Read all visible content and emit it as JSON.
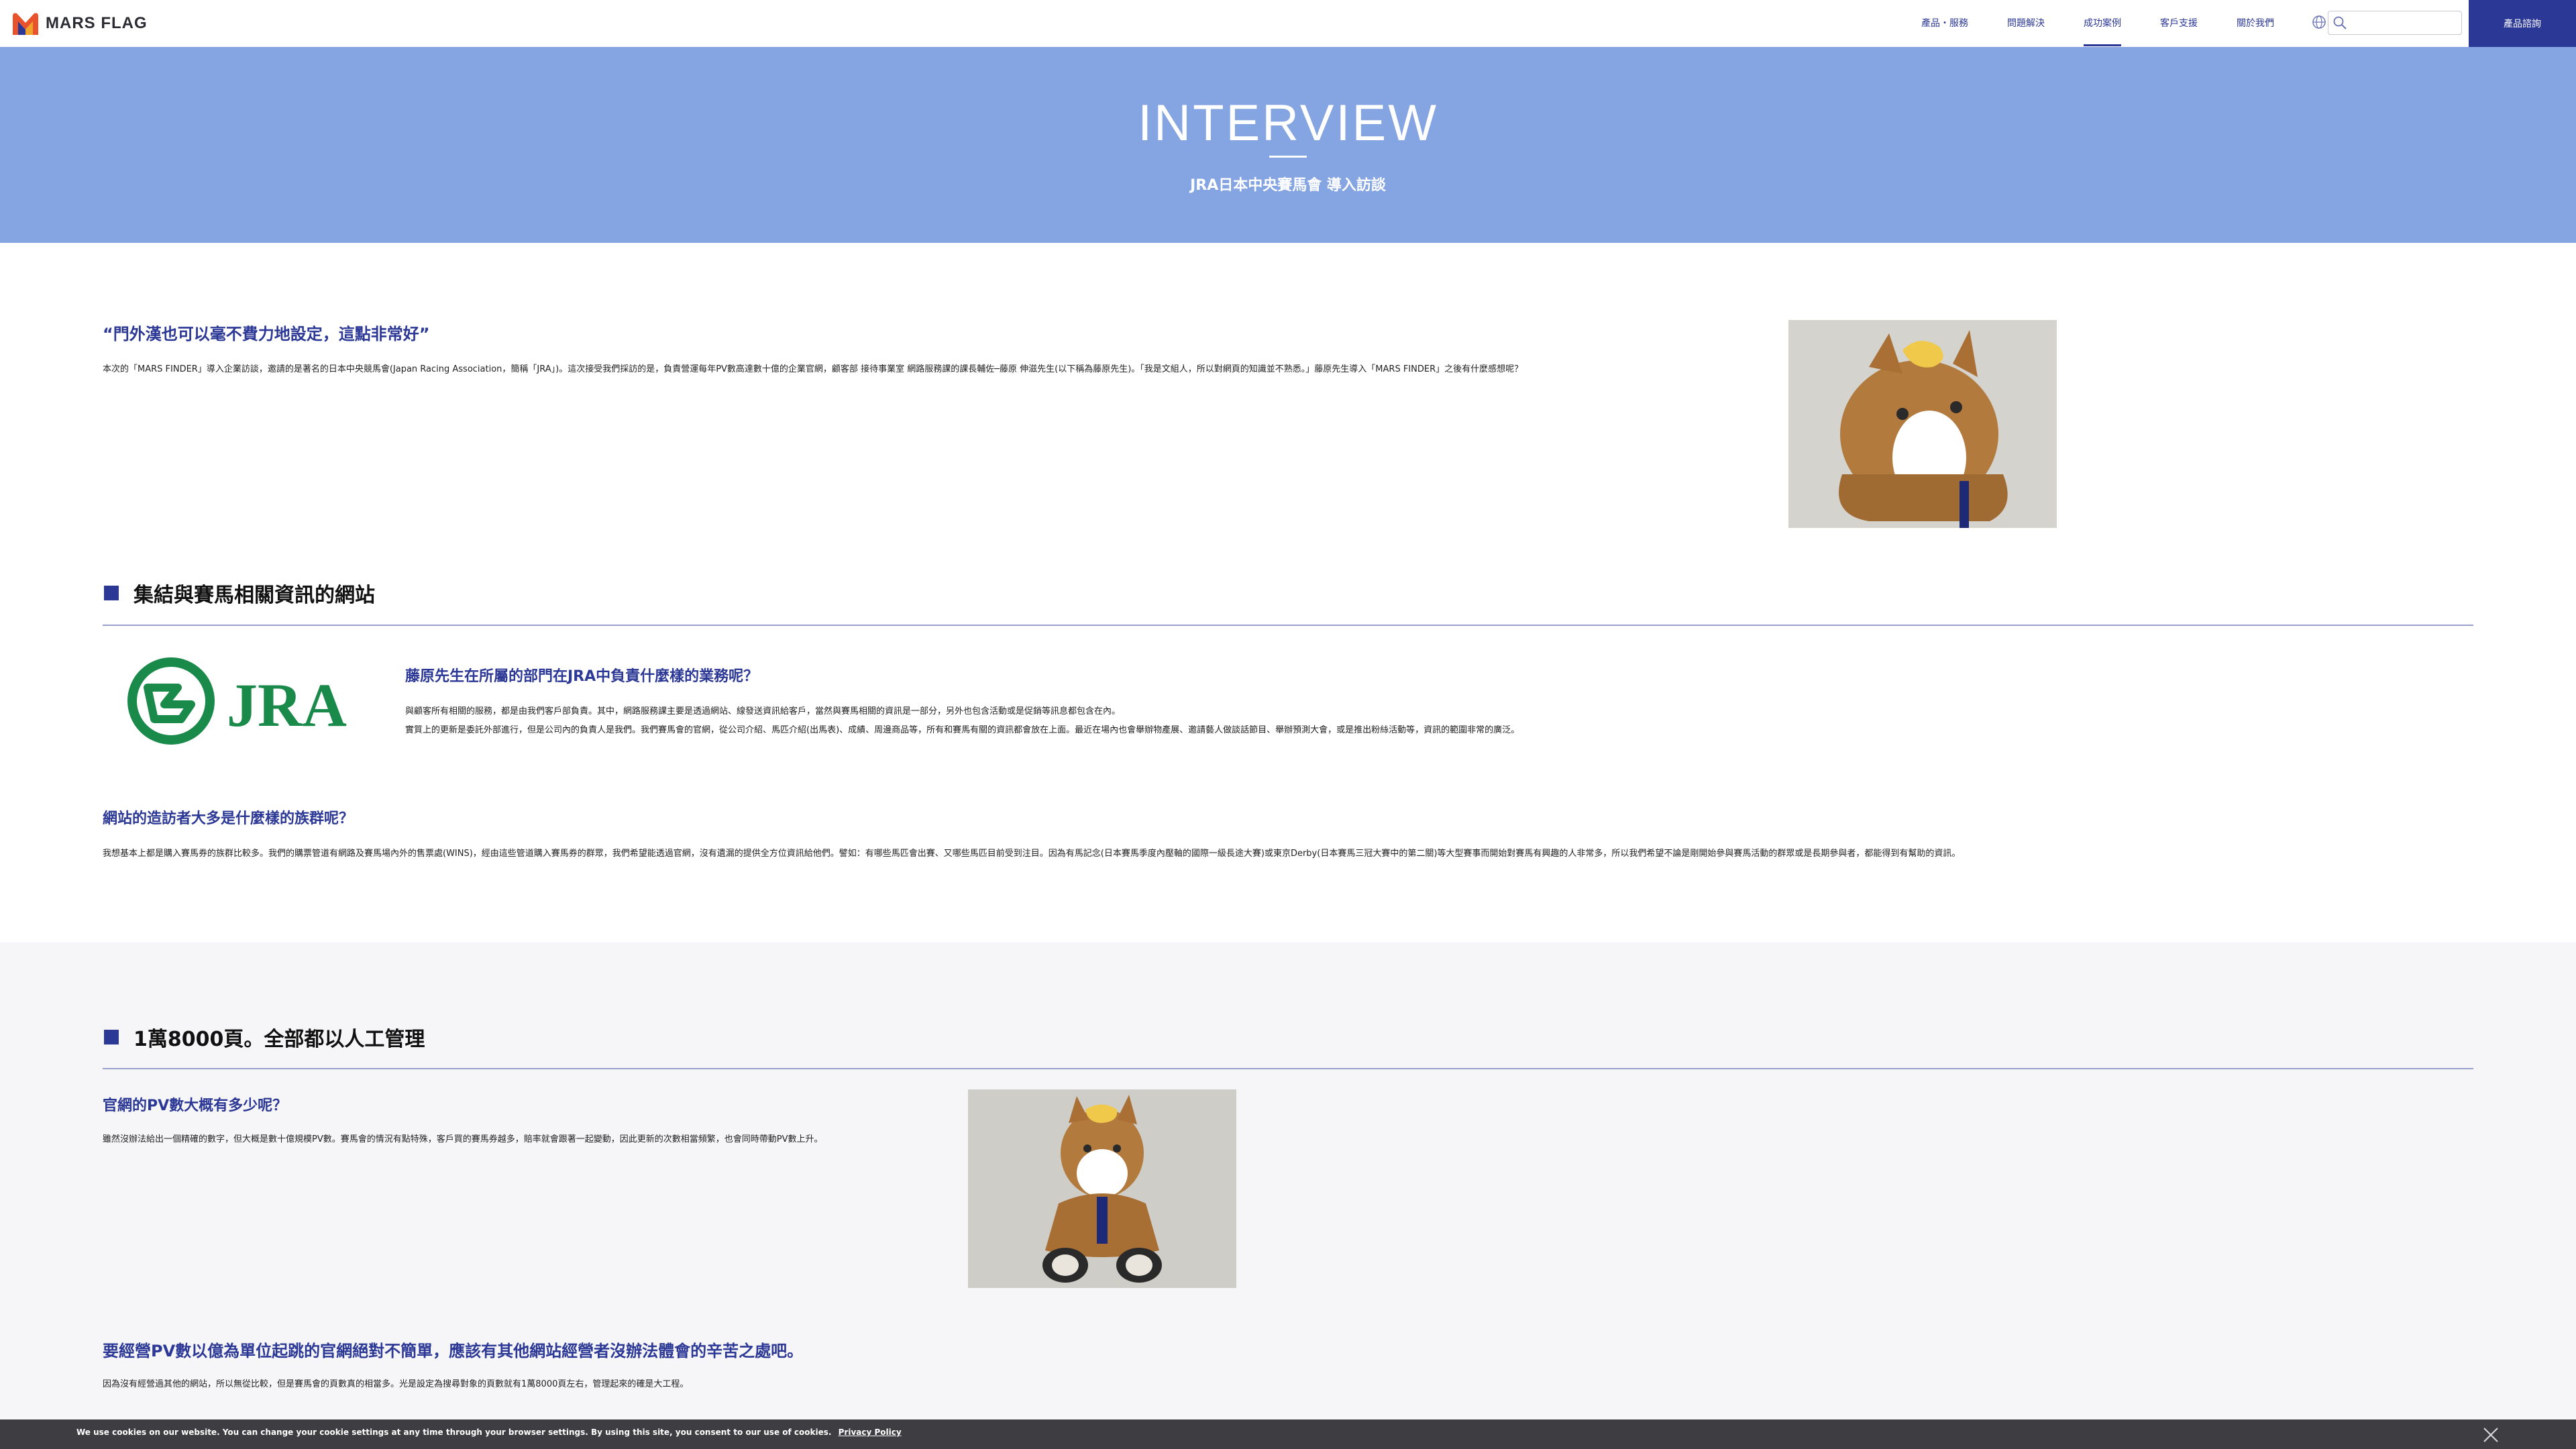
{
  "header": {
    "logo_text": "MARS FLAG",
    "nav": [
      {
        "label": "產品・服務"
      },
      {
        "label": "問題解決"
      },
      {
        "label": "成功案例",
        "active": true
      },
      {
        "label": "客戶支援"
      },
      {
        "label": "關於我們"
      }
    ],
    "search_placeholder": "",
    "cta_label": "產品諮詢"
  },
  "hero": {
    "title": "INTERVIEW",
    "subtitle": "JRA日本中央賽馬會 導入訪談"
  },
  "intro": {
    "heading": "“門外漢也可以毫不費力地設定，這點非常好”",
    "text": "本次的「MARS FINDER」導入企業訪談，邀請的是著名的日本中央競馬會(Japan Racing Association，簡稱「JRA」)。這次接受我們採訪的是，負責營運每年PV數高達數十億的企業官網，顧客部 接待事業室 網路服務課的課長輔佐─藤原 伸滋先生(以下稱為藤原先生)。「我是文組人，所以對網頁的知識並不熟悉。」藤原先生導入「MARS FINDER」之後有什麼感想呢？"
  },
  "section1": {
    "title": "集結與賽馬相關資訊的網站",
    "jra_logo_text": "JRA",
    "q1": "藤原先生在所屬的部門在JRA中負責什麼樣的業務呢？",
    "a1_line1": "與顧客所有相關的服務，都是由我們客戶部負責。其中，網路服務課主要是透過網站、線發送資訊給客戶，當然與賽馬相關的資訊是一部分，另外也包含活動或是促銷等訊息都包含在內。",
    "a1_line2": "實質上的更新是委託外部進行，但是公司內的負責人是我們。我們賽馬會的官網，從公司介紹、馬匹介紹(出馬表)、成績、周邊商品等，所有和賽馬有關的資訊都會放在上面。最近在場內也會舉辦物產展、邀請藝人做談話節目、舉辦預測大會，或是推出粉絲活動等，資訊的範圍非常的廣泛。",
    "q2": "網站的造訪者大多是什麼樣的族群呢？",
    "a2": "我想基本上都是購入賽馬券的族群比較多。我們的購票管道有網路及賽馬場內外的售票處(WINS)，經由這些管道購入賽馬券的群眾，我們希望能透過官網，沒有遺漏的提供全方位資訊給他們。譬如：有哪些馬匹會出賽、又哪些馬匹目前受到注目。因為有馬記念(日本賽馬季度內壓軸的國際一級長途大賽)或東京Derby(日本賽馬三冠大賽中的第二關)等大型賽事而開始對賽馬有興趣的人非常多，所以我們希望不論是剛開始參與賽馬活動的群眾或是長期參與者，都能得到有幫助的資訊。"
  },
  "section2": {
    "title": "1萬8000頁。全部都以人工管理",
    "q1": "官網的PV數大概有多少呢？",
    "a1": "雖然沒辦法給出一個精確的數字，但大概是數十億規模PV數。賽馬會的情況有點特殊，客戶買的賽馬券越多，賠率就會跟著一起變動，因此更新的次數相當頻繁，也會同時帶動PV數上升。",
    "q2": "要經營PV數以億為單位起跳的官網絕對不簡單，應該有其他網站經營者沒辦法體會的辛苦之處吧。",
    "a2": "因為沒有經營過其他的網站，所以無從比較，但是賽馬會的頁數真的相當多。光是設定為搜尋對象的頁數就有1萬8000頁左右，管理起來的確是大工程。"
  },
  "cookie": {
    "text": "We use cookies on our website. You can change your cookie settings at any time through your browser settings. By using this site, you consent to our use of cookies.",
    "link": "Privacy Policy"
  },
  "colors": {
    "brand": "#2c3895",
    "hero_bg": "#84a4e2",
    "jra_green": "#1a8a4a",
    "cookie_bg": "#3e3e42"
  },
  "icons": [
    "globe-icon",
    "search-icon",
    "close-icon"
  ]
}
